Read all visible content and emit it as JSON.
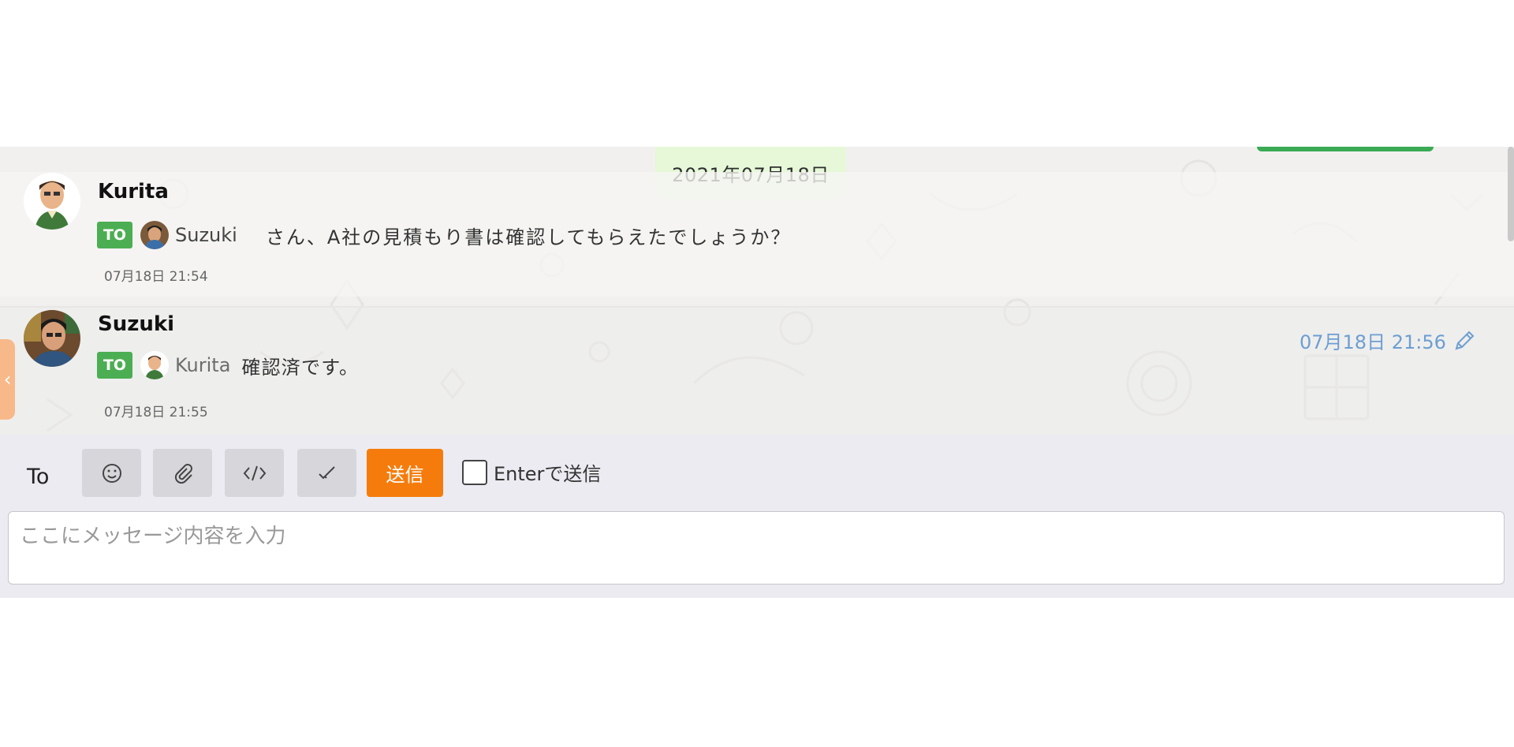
{
  "date_badge": "2021年07月18日",
  "messages": [
    {
      "sender": "Kurita",
      "to_badge": "TO",
      "to_name": "Suzuki",
      "text": "さん、A社の見積もり書は確認してもらえたでしょうか？",
      "time": "07月18日 21:54"
    },
    {
      "sender": "Suzuki",
      "to_badge": "TO",
      "to_name": "Kurita",
      "text": "確認済です。",
      "time": "07月18日 21:55",
      "hover_time": "07月18日 21:56"
    }
  ],
  "composer": {
    "to_label": "To",
    "send_label": "送信",
    "enter_send_label": "Enterで送信",
    "enter_send_checked": false,
    "placeholder": "ここにメッセージ内容を入力",
    "tools": [
      "emoji-icon",
      "attachment-icon",
      "code-icon",
      "check-icon"
    ]
  },
  "colors": {
    "to_badge": "#4cae52",
    "send_button": "#f57c0c",
    "date_badge_bg": "#e6f8d8",
    "hover_time": "#6d9ed1",
    "side_tab": "#f8b98a"
  }
}
